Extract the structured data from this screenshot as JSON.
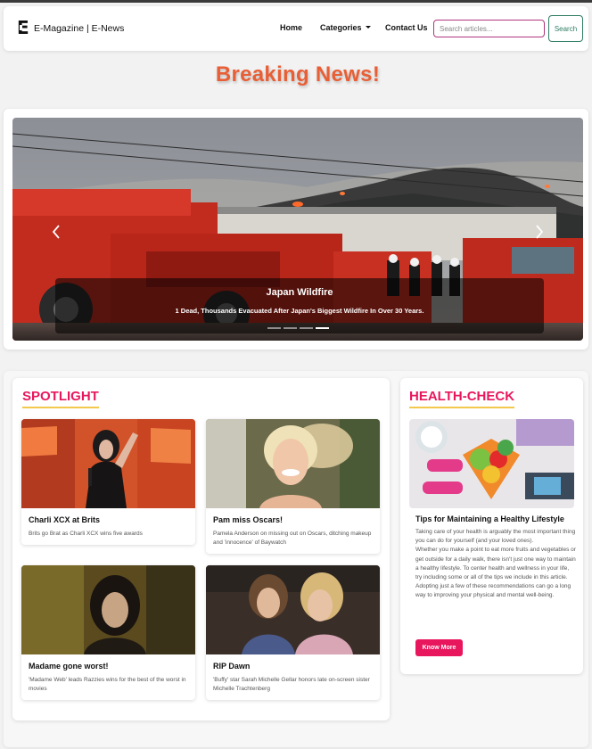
{
  "navbar": {
    "brand_name": "E-Magazine | E-News",
    "links": [
      {
        "label": "Home"
      },
      {
        "label": "Categories"
      },
      {
        "label": "Contact Us"
      }
    ],
    "search_placeholder": "Search articles...",
    "search_button_label": "Search"
  },
  "breaking": {
    "title": "Breaking News!"
  },
  "carousel": {
    "caption_title": "Japan Wildfire",
    "caption_text": "1 Dead, Thousands Evacuated After Japan's Biggest Wildfire In Over 30 Years.",
    "slide_count": 4,
    "active_index": 3
  },
  "spotlight": {
    "heading": "SPOTLIGHT",
    "cards": [
      {
        "title": "Charli XCX at Brits",
        "text": "Brits go Brat as Charli XCX wins five awards"
      },
      {
        "title": "Pam miss Oscars!",
        "text": "Pamela Anderson on missing out on Oscars, ditching makeup and 'innocence' of Baywatch"
      },
      {
        "title": "Madame gone worst!",
        "text": "'Madame Web' leads Razzies wins for the best of the worst in movies"
      },
      {
        "title": "RIP Dawn",
        "text": "'Buffy' star Sarah Michelle Gellar honors late on-screen sister Michelle Trachtenberg"
      }
    ]
  },
  "health": {
    "heading": "HEALTH-CHECK",
    "title": "Tips for Maintaining a Healthy Lifestyle",
    "paragraphs": [
      "Taking care of your health is arguably the most important thing you can do for yourself (and your loved ones).",
      "Whether you make a point to eat more fruits and vegetables or get outside for a daily walk, there isn't just one way to maintain a healthy lifestyle. To center health and wellness in your life, try including some or all of the tips we include in this article.",
      "Adopting just a few of these recommendations can go a long way to improving your physical and mental well-being."
    ],
    "button_label": "Know More"
  },
  "colors": {
    "accent_pink": "#e8175d",
    "breaking_orange": "#e85f36",
    "heading_underline": "#f2c94c",
    "search_border": "#b0357d",
    "search_button": "#2e7d63"
  }
}
